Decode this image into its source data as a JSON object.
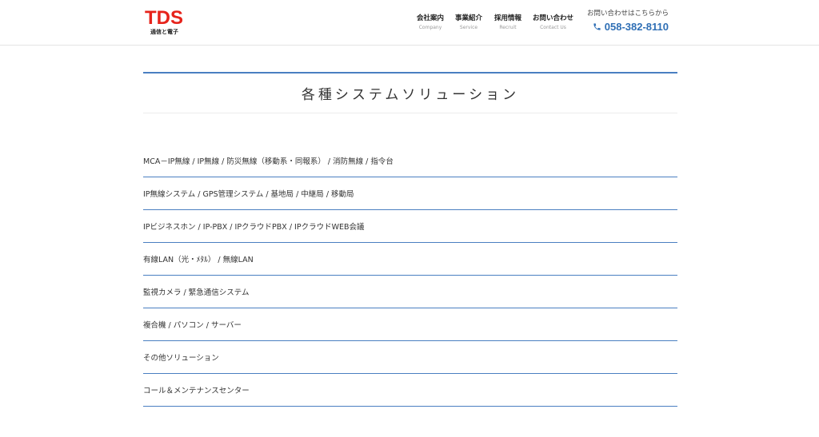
{
  "logo": {
    "main": "TDS",
    "sub": "通信と電子"
  },
  "nav": [
    {
      "label": "会社案内",
      "sub": "Company"
    },
    {
      "label": "事業紹介",
      "sub": "Service"
    },
    {
      "label": "採用情報",
      "sub": "Recruit"
    },
    {
      "label": "お問い合わせ",
      "sub": "Contact Us"
    }
  ],
  "contact": {
    "label": "お問い合わせはこちらから",
    "phone": "058-382-8110",
    "icon": "phone-icon"
  },
  "page": {
    "title": "各種システムソリューション"
  },
  "solutions": [
    "MCA－IP無線 / IP無線 / 防災無線（移動系・同報系） / 消防無線 / 指令台",
    "IP無線システム / GPS管理システム / 基地局 / 中継局 / 移動局",
    "IPビジネスホン / IP-PBX / IPクラウドPBX / IPクラウドWEB会議",
    "有線LAN（光・ﾒﾀﾙ） / 無線LAN",
    "監視カメラ / 緊急通信システム",
    "複合機 / パソコン / サーバー",
    "その他ソリューション",
    "コール＆メンテナンスセンター"
  ],
  "colors": {
    "brand_red": "#e6231b",
    "accent_blue": "#4a7fc1",
    "phone_blue": "#2f6fb5"
  }
}
